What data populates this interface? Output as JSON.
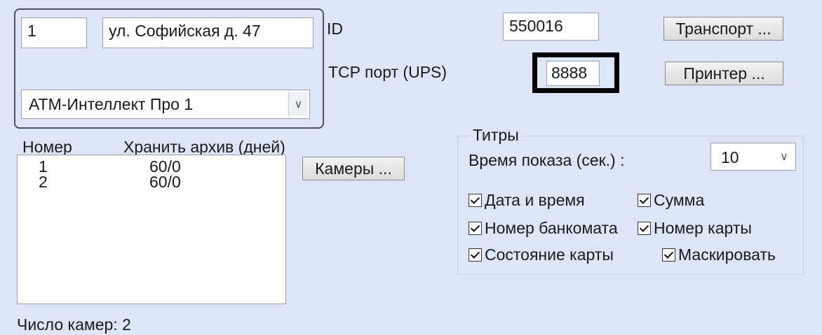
{
  "atm": {
    "number": "1",
    "address": "ул. Софийская д. 47",
    "type": "АТМ-Интеллект Про 1"
  },
  "id_label": "ID",
  "id_value": "550016",
  "tcp_label": "TCP порт (UPS)",
  "tcp_value": "8888",
  "buttons": {
    "transport": "Транспорт ...",
    "printer": "Принтер ...",
    "cameras": "Камеры ..."
  },
  "camera_list": {
    "headers": [
      "Номер",
      "Хранить архив (дней)"
    ],
    "rows": [
      {
        "number": "1",
        "archive": "60/0"
      },
      {
        "number": "2",
        "archive": "60/0"
      }
    ],
    "count_label": "Число камер: 2"
  },
  "titles": {
    "legend": "Титры",
    "show_time_label": "Время показа (сек.) :",
    "show_time_value": "10",
    "checkboxes": [
      {
        "label": "Дата и время",
        "checked": true
      },
      {
        "label": "Сумма",
        "checked": true
      },
      {
        "label": "Номер банкомата",
        "checked": true
      },
      {
        "label": "Номер карты",
        "checked": true
      },
      {
        "label": "Состояние карты",
        "checked": true
      },
      {
        "label": "Маскировать",
        "checked": true
      }
    ]
  }
}
